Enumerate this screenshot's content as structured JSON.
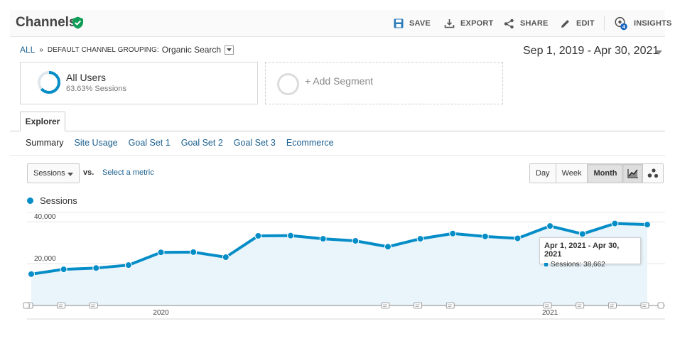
{
  "header": {
    "title": "Channels",
    "actions": [
      {
        "label": "SAVE",
        "icon": "save-icon"
      },
      {
        "label": "EXPORT",
        "icon": "export-icon"
      },
      {
        "label": "SHARE",
        "icon": "share-icon"
      },
      {
        "label": "EDIT",
        "icon": "edit-icon"
      },
      {
        "label": "INSIGHTS",
        "icon": "insights-icon",
        "badge": "4"
      }
    ]
  },
  "breadcrumb": {
    "all": "ALL",
    "separator": "»",
    "grouping": "DEFAULT CHANNEL GROUPING:",
    "value": "Organic Search"
  },
  "date_range": "Sep 1, 2019 - Apr 30, 2021",
  "segments": {
    "primary": {
      "name": "All Users",
      "detail": "63.63% Sessions",
      "share": 0.6363
    },
    "add_label": "+ Add Segment"
  },
  "tabs": {
    "explorer": "Explorer"
  },
  "subnav": [
    "Summary",
    "Site Usage",
    "Goal Set 1",
    "Goal Set 2",
    "Goal Set 3",
    "Ecommerce"
  ],
  "controls": {
    "metric": "Sessions",
    "vs": "vs.",
    "select_metric": "Select a metric",
    "granularity": [
      "Day",
      "Week",
      "Month"
    ],
    "granularity_selected": "Month"
  },
  "legend": {
    "series": "Sessions"
  },
  "tooltip": {
    "title": "Apr 1, 2021 - Apr 30, 2021",
    "row": "Sessions: 38,662"
  },
  "colors": {
    "accent": "#058dc7",
    "link": "#1a5f8f",
    "verified": "#0f9d58"
  },
  "chart_data": {
    "type": "area",
    "x": [
      "2019-09",
      "2019-10",
      "2019-11",
      "2019-12",
      "2020-01",
      "2020-02",
      "2020-03",
      "2020-04",
      "2020-05",
      "2020-06",
      "2020-07",
      "2020-08",
      "2020-09",
      "2020-10",
      "2020-11",
      "2020-12",
      "2021-01",
      "2021-02",
      "2021-03",
      "2021-04"
    ],
    "series": [
      {
        "name": "Sessions",
        "values": [
          15000,
          17300,
          17900,
          19300,
          25400,
          25500,
          23100,
          33300,
          33400,
          31900,
          30900,
          28100,
          31900,
          34400,
          33000,
          32100,
          38000,
          34200,
          39200,
          38662
        ]
      }
    ],
    "ylim": [
      0,
      44500
    ],
    "yticks": [
      {
        "value": 20000,
        "label": "20,000"
      },
      {
        "value": 40000,
        "label": "40,000"
      }
    ],
    "xticks": [
      {
        "x": "2020-01",
        "label": "2020"
      },
      {
        "x": "2021-01",
        "label": "2021"
      }
    ],
    "annotation_markers": [
      "2019-09",
      "2019-10",
      "2019-11",
      "2020-08",
      "2020-09",
      "2020-10",
      "2021-01",
      "2021-02",
      "2021-03",
      "2021-04"
    ],
    "grid": true,
    "legend": "top-left"
  }
}
